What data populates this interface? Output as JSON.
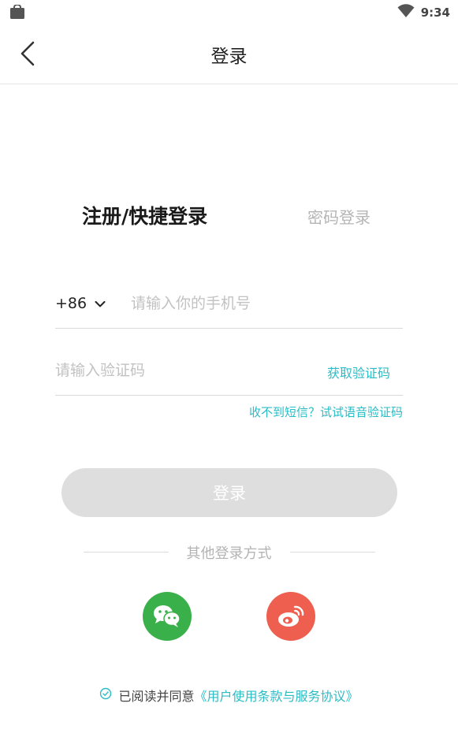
{
  "status_bar": {
    "time": "9:34"
  },
  "nav": {
    "title": "登录"
  },
  "tabs": {
    "quick_login": "注册/快捷登录",
    "password_login": "密码登录"
  },
  "phone": {
    "country_code": "+86",
    "placeholder": "请输入你的手机号",
    "value": ""
  },
  "code": {
    "placeholder": "请输入验证码",
    "value": "",
    "get_code_label": "获取验证码",
    "voice_hint": "收不到短信？试试语音验证码"
  },
  "login_button": {
    "label": "登录",
    "enabled": false
  },
  "other_login": {
    "label": "其他登录方式",
    "providers": [
      "wechat-icon",
      "weibo-icon"
    ]
  },
  "agreement": {
    "prefix": "已阅读并同意",
    "link": "《用户使用条款与服务协议》"
  },
  "colors": {
    "accent": "#2bbcc5",
    "wechat": "#39b04a",
    "weibo": "#ee5f4f",
    "disabled_button": "#dedede"
  }
}
